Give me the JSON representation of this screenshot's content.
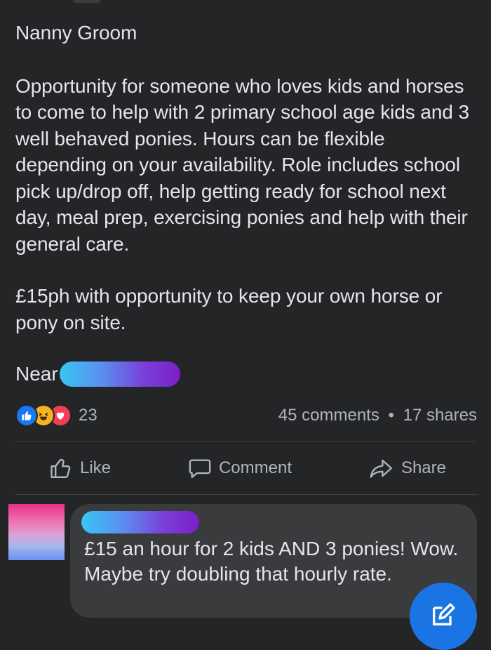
{
  "post": {
    "title": "Nanny Groom",
    "body": "Opportunity for someone who loves kids and horses to come to help with 2 primary school age kids and 3 well behaved ponies. Hours can be flexible depending on your availability. Role includes school pick up/drop off, help getting ready for school next day, meal prep, exercising ponies and help with their general care.",
    "pay": "£15ph with opportunity to keep your own horse or pony on site.",
    "location_prefix": "Near"
  },
  "stats": {
    "reaction_icons": [
      "like-icon",
      "haha-icon",
      "love-icon"
    ],
    "reaction_count": "23",
    "comments": "45 comments",
    "separator": "•",
    "shares": "17 shares"
  },
  "actions": {
    "like": "Like",
    "comment": "Comment",
    "share": "Share"
  },
  "comment": {
    "text": "£15 an hour for 2 kids AND 3 ponies! Wow. Maybe try doubling that hourly rate."
  },
  "colors": {
    "background": "#242526",
    "text": "#e4e6eb",
    "muted": "#b0b3b8",
    "comment_bubble": "#3a3b3c",
    "fab": "#1b74e4"
  }
}
